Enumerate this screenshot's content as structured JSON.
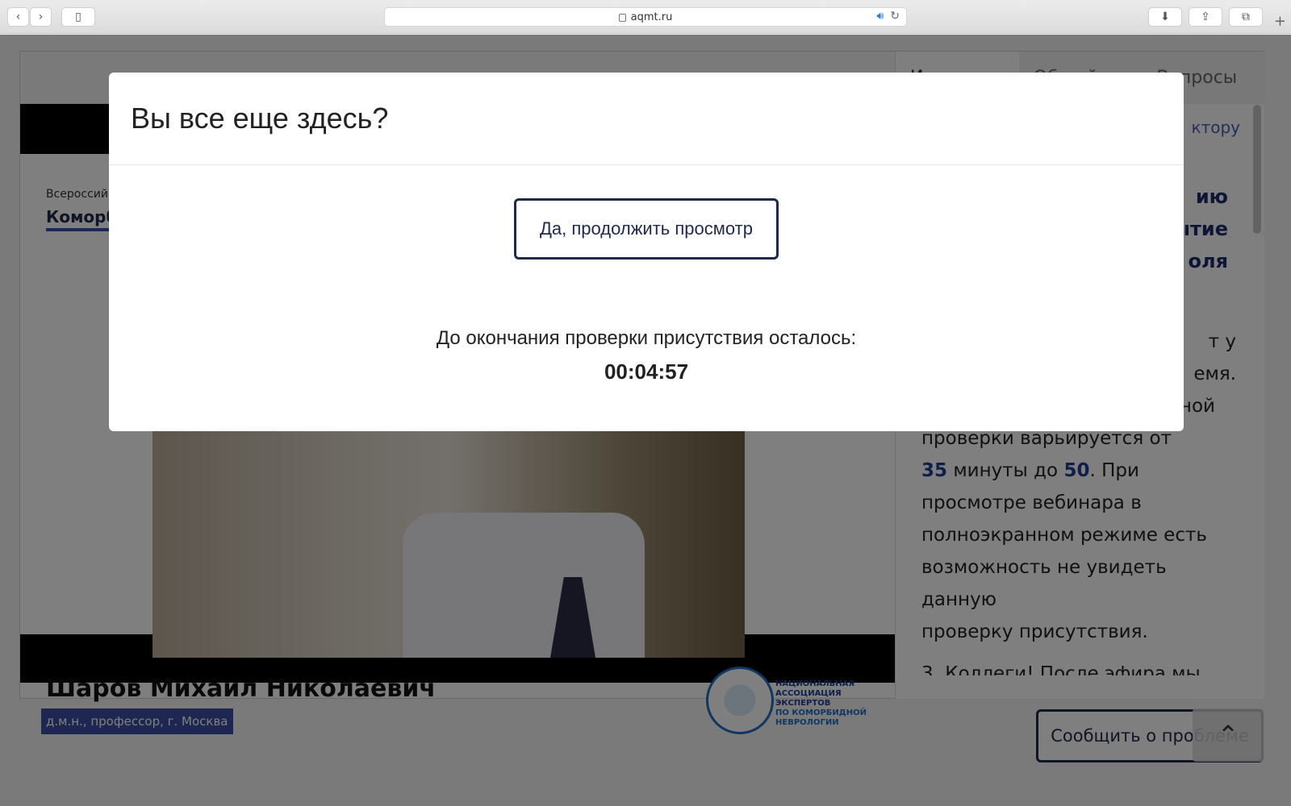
{
  "browser": {
    "url": "aqmt.ru",
    "back_icon": "chevron-left-icon",
    "forward_icon": "chevron-right-icon",
    "sidebar_icon": "sidebar-icon",
    "download_icon": "download-icon",
    "share_icon": "share-icon",
    "tabs_icon": "tabs-icon",
    "newtab_icon": "plus-icon"
  },
  "page": {
    "slide": {
      "top_small": "Всероссий",
      "top_bold": "Коморб"
    },
    "speaker": {
      "name": "Шаров Михаил Николаевич",
      "title": "д.м.н., профессор, г. Москва"
    },
    "org": {
      "line1": "НАЦИОНАЛЬНАЯ",
      "line2": "АССОЦИАЦИЯ",
      "line3": "ЭКСПЕРТОВ",
      "line4": "ПО КОМОРБИДНОЙ",
      "line5": "НЕВРОЛОГИИ"
    },
    "sidebar": {
      "tabs": [
        {
          "label": "И"
        },
        {
          "label": "Общий"
        },
        {
          "label": "Вопросы"
        }
      ],
      "link": "ктору",
      "heading_lines": [
        "ию",
        "ытие",
        "оля"
      ],
      "body_line1": "т у",
      "body_line2": "емя.",
      "body_line3": "Период возникновения одной",
      "body_line4": "проверки варьируется от",
      "body_num1": "35",
      "body_mid": " минуты до ",
      "body_num2": "50",
      "body_end": ". При",
      "body_line6": "просмотре вебинара в",
      "body_line7": "полноэкранном режиме есть",
      "body_line8": "возможность не увидеть данную",
      "body_line9": "проверку присутствия.",
      "body_line10": "3. Коллеги! После эфира мы"
    },
    "report_button": "Сообщить о проблеме"
  },
  "modal": {
    "title": "Вы все еще здесь?",
    "continue_label": "Да, продолжить просмотр",
    "countdown_label": "До окончания проверки присутствия осталось:",
    "countdown_time": "00:04:57"
  }
}
